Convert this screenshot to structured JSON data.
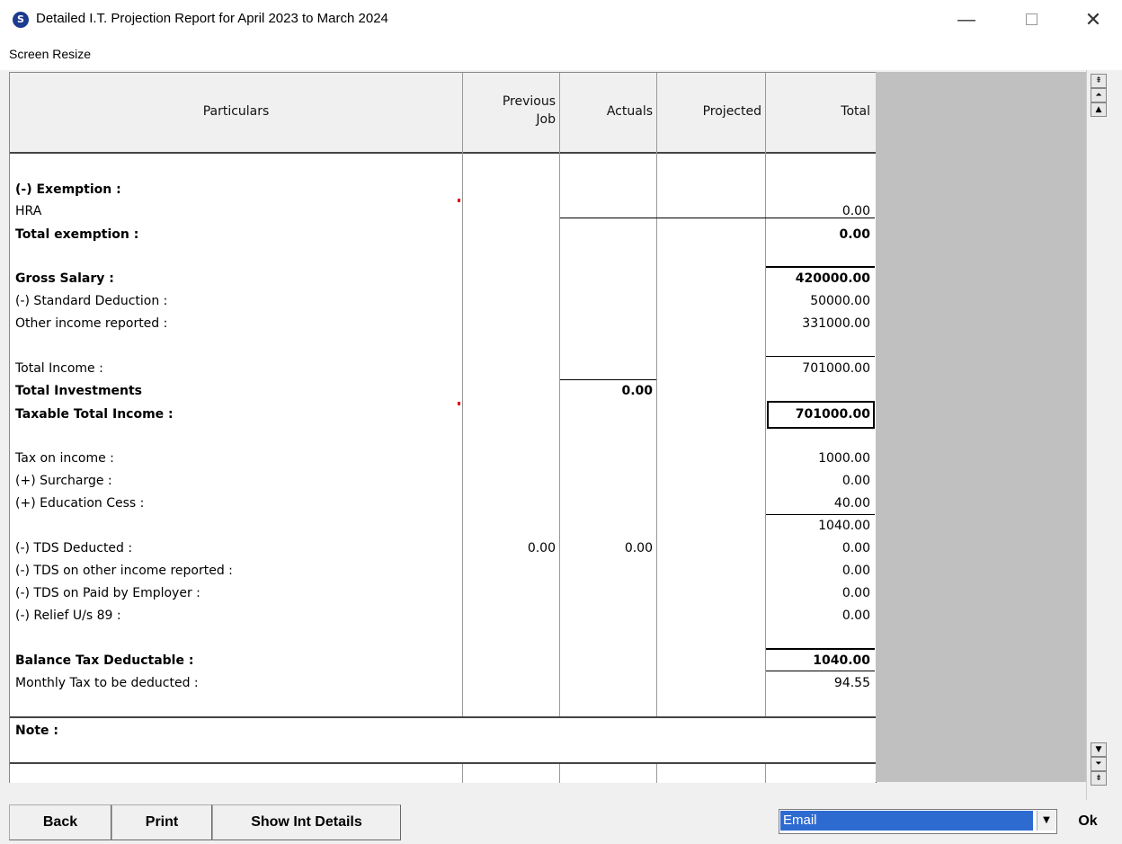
{
  "window": {
    "title": "Detailed I.T. Projection Report for April 2023 to March 2024",
    "app_icon_glyph": "S",
    "minimize": "—",
    "close": "✕"
  },
  "menu": {
    "screen_resize": "Screen Resize"
  },
  "columns": {
    "particulars": "Particulars",
    "previous_job_line1": "Previous",
    "previous_job_line2": "Job",
    "actuals": "Actuals",
    "projected": "Projected",
    "total": "Total"
  },
  "rows": {
    "exemption_heading": "(-) Exemption :",
    "hra": "HRA",
    "hra_total": "0.00",
    "total_exemption": "Total exemption :",
    "total_exemption_value": "0.00",
    "gross_salary": "Gross Salary :",
    "gross_salary_value": "420000.00",
    "standard_deduction": "(-) Standard Deduction :",
    "standard_deduction_value": "50000.00",
    "other_income": "Other income reported :",
    "other_income_value": "331000.00",
    "total_income": "Total Income :",
    "total_income_value": "701000.00",
    "total_investments": "Total Investments",
    "total_investments_actuals": "0.00",
    "taxable_total_income": "Taxable Total Income :",
    "taxable_total_income_value": "701000.00",
    "tax_on_income": "Tax on income :",
    "tax_on_income_value": "1000.00",
    "surcharge": "(+) Surcharge :",
    "surcharge_value": "0.00",
    "education_cess": "(+) Education Cess :",
    "education_cess_value": "40.00",
    "subtotal_value": "1040.00",
    "tds_deducted": "(-) TDS Deducted :",
    "tds_deducted_previous": "0.00",
    "tds_deducted_actuals": "0.00",
    "tds_deducted_total": "0.00",
    "tds_other_income": "(-) TDS on other income reported :",
    "tds_other_income_value": "0.00",
    "tds_paid_employer": "(-) TDS on Paid by Employer :",
    "tds_paid_employer_value": "0.00",
    "relief_89": "(-) Relief U/s 89 :",
    "relief_89_value": "0.00",
    "balance_tax": "Balance Tax Deductable :",
    "balance_tax_value": "1040.00",
    "monthly_tax": "Monthly Tax to be deducted :",
    "monthly_tax_value": "94.55",
    "note": "Note :"
  },
  "scrollbar": {
    "top": "⇞",
    "page_up": "⏶",
    "up": "▲",
    "down": "▼",
    "page_down": "⏷",
    "bottom": "⇟"
  },
  "footer": {
    "back": "Back",
    "print": "Print",
    "show_int_details": "Show Int Details",
    "output_select": "Email",
    "ok": "Ok"
  }
}
